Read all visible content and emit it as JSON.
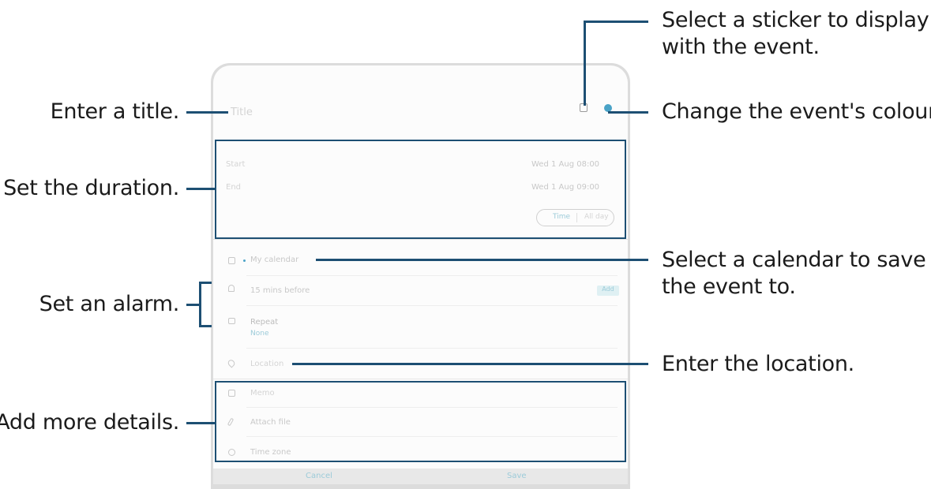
{
  "callouts": {
    "sticker": [
      "Select a sticker to display",
      "with the event."
    ],
    "colour": "Change the event's colour.",
    "title": "Enter a title.",
    "duration": "Set the duration.",
    "calendar": [
      "Select a calendar to save",
      "the event to."
    ],
    "alarm": "Set an alarm.",
    "location": "Enter the location.",
    "details": "Add more details."
  },
  "screen": {
    "title_placeholder": "Title",
    "start_label": "Start",
    "start_value": "Wed 1 Aug 08:00",
    "end_label": "End",
    "end_value": "Wed 1 Aug 09:00",
    "toggle": [
      "Time",
      "All day"
    ],
    "calendar_value": "My calendar",
    "alarm_value": "15 mins before",
    "alarm_add": "Add",
    "repeat_label": "Repeat",
    "repeat_value": "None",
    "location_placeholder": "Location",
    "memo_label": "Memo",
    "attach_label": "Attach file",
    "timezone_label": "Time zone",
    "cancel": "Cancel",
    "save": "Save"
  },
  "colors": {
    "accent": "#4aa3c7",
    "line": "#1d4f73"
  }
}
